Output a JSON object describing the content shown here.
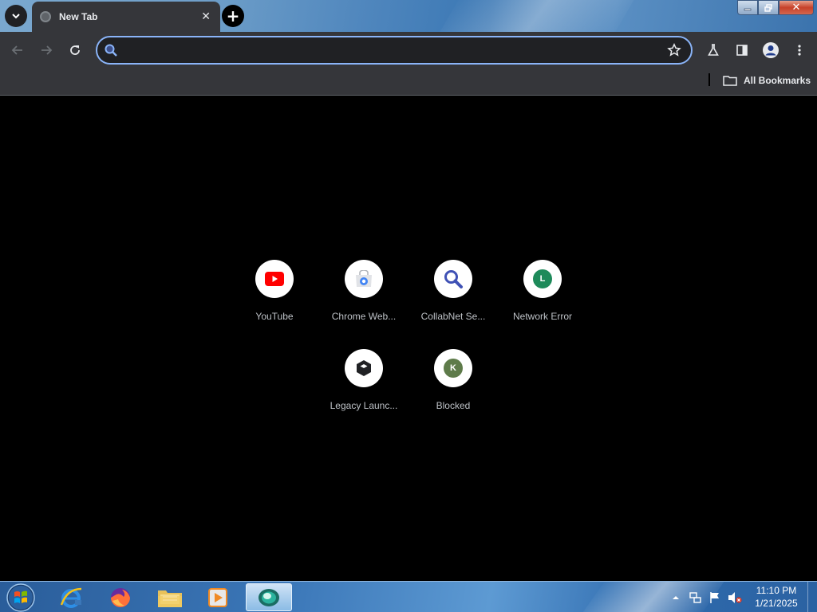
{
  "window": {
    "controls": {
      "minimize": "▬",
      "maximize": "❐",
      "close": "✕"
    }
  },
  "tabs": [
    {
      "title": "New Tab",
      "close": "✕",
      "active": true
    }
  ],
  "new_tab_symbol": "+",
  "omnibox": {
    "value": "",
    "placeholder": ""
  },
  "toolbar_icons": [
    "back-icon",
    "forward-icon",
    "reload-icon",
    "search-icon",
    "star-icon",
    "labs-icon",
    "side-panel-icon",
    "profile-icon",
    "menu-icon"
  ],
  "bookmarks_bar": {
    "all_bookmarks_label": "All Bookmarks"
  },
  "shortcuts": [
    {
      "label": "YouTube",
      "icon": "youtube-icon",
      "color": "#ff0000"
    },
    {
      "label": "Chrome Web...",
      "icon": "chrome-web-store-icon",
      "color": "#4285f4"
    },
    {
      "label": "CollabNet Se...",
      "icon": "magnifier-icon",
      "color": "#3f51b5"
    },
    {
      "label": "Network Error",
      "icon": "letter-icon",
      "letter": "L",
      "color": "#1e8a5a"
    },
    {
      "label": "Legacy Launc...",
      "icon": "cube-icon",
      "color": "#202124"
    },
    {
      "label": "Blocked",
      "icon": "letter-icon",
      "letter": "K",
      "color": "#5e7b4a"
    }
  ],
  "taskbar": {
    "apps": [
      "start-orb-icon",
      "internet-explorer-icon",
      "firefox-icon",
      "file-explorer-icon",
      "media-player-icon",
      "chrome-app-icon"
    ],
    "active_app": "chrome-app-icon",
    "tray_icons": [
      "show-hidden-icons",
      "network-icon",
      "action-center-flag-icon",
      "volume-muted-icon"
    ],
    "clock": {
      "time": "11:10 PM",
      "date": "1/21/2025"
    }
  },
  "colors": {
    "accent": "#8ab4f8",
    "toolbar": "#35363a",
    "content_bg": "#000000"
  }
}
